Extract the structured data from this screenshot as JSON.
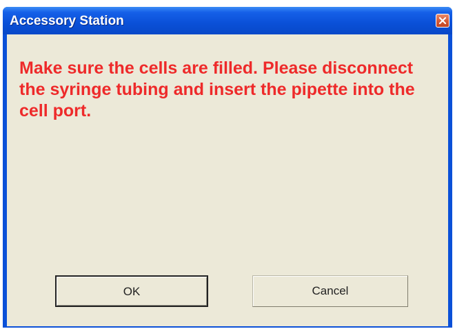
{
  "window": {
    "title": "Accessory Station"
  },
  "dialog": {
    "message": "Make sure the cells are filled. Please disconnect the syringe tubing and insert the pipette into the cell port."
  },
  "buttons": {
    "ok_label": "OK",
    "cancel_label": "Cancel"
  },
  "icons": {
    "close": "close-icon"
  },
  "colors": {
    "titlebar": "#0a50d8",
    "message_text": "#ee2a2a",
    "client_background": "#ece9d8",
    "close_button": "#d55a36"
  }
}
